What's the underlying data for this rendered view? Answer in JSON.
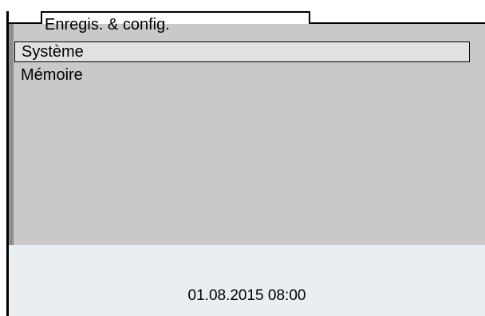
{
  "header": {
    "title": "Enregis. & config."
  },
  "menu": {
    "items": [
      {
        "label": "Système",
        "selected": true
      },
      {
        "label": "Mémoire",
        "selected": false
      }
    ]
  },
  "status": {
    "datetime": "01.08.2015 08:00"
  },
  "colors": {
    "panel": "#cbc8c8",
    "selection": "#e1e1e1",
    "status_bar": "#e8eef2"
  }
}
